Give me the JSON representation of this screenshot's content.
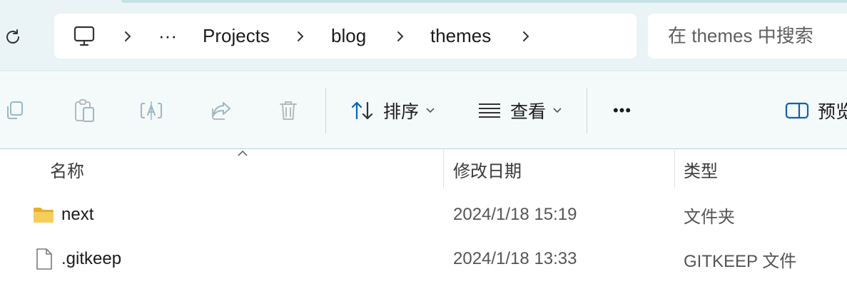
{
  "address_bar": {
    "crumbs": [
      "···",
      "Projects",
      "blog",
      "themes"
    ]
  },
  "search": {
    "placeholder": "在 themes 中搜索"
  },
  "toolbar": {
    "sort_label": "排序",
    "view_label": "查看",
    "more_label": "•••",
    "preview_label": "预览"
  },
  "columns": {
    "name": "名称",
    "date": "修改日期",
    "type": "类型"
  },
  "files": [
    {
      "name": "next",
      "date": "2024/1/18 15:19",
      "type": "文件夹",
      "icon": "folder-icon"
    },
    {
      "name": ".gitkeep",
      "date": "2024/1/18 13:33",
      "type": "GITKEEP 文件",
      "icon": "file-icon"
    }
  ],
  "colors": {
    "top_band": "#eaf4f6",
    "toolbar": "#f4f9fa",
    "accent": "#0a62b8",
    "folder": "#f2c14e"
  }
}
